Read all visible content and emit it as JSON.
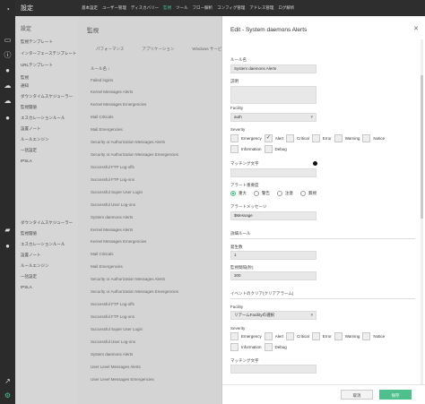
{
  "app": {
    "title": "設定"
  },
  "topnav": [
    "基本設定",
    "ユーザー管理",
    "ディスカバリー",
    "監視",
    "ツール",
    "フロー解析",
    "コンフィグ管理",
    "アドレス管理",
    "ログ解析"
  ],
  "topnav_active_index": 3,
  "rail_icons": [
    "dashboard-icon",
    "desktop-icon",
    "info-icon",
    "map-pin-icon",
    "cloud-icon",
    "user-icon",
    "chat-icon",
    "user-icon",
    "chart-icon",
    "settings-icon"
  ],
  "sidebar": {
    "heading": "設定",
    "items": [
      "監視テンプレート",
      "インターフェーステンプレート",
      "URLテンプレート",
      "監視",
      "通知",
      "ダウンタイムスケジューラー",
      "監視閾値",
      "エスカレーションルール",
      "設置ノート",
      "ルールエンジン",
      "一括設定",
      "IPSLA",
      "",
      "",
      "",
      "",
      "ダウンタイムスケジューラー",
      "監視閾値",
      "エスカレーションルール",
      "設置ノート",
      "ルールエンジン",
      "一括設定",
      "IPSLA"
    ]
  },
  "main": {
    "heading": "監視",
    "tabs": [
      "パフォーマンス",
      "アプリケーション",
      "Windows サービス"
    ],
    "column_header": "ルール名 ↓",
    "rows": [
      "Failed logins",
      "Kernel Messages Alerts",
      "Kernel Messages Emergencies",
      "Mail Criticals",
      "Mail Emergencies",
      "Security or Authorization Messages Alerts",
      "Security or Authorization Messages Emergencies",
      "Successful FTP Log-offs",
      "Successful FTP Log-ons",
      "Successful Super User Login",
      "Successful User Log-ons",
      "System daemons Alerts",
      "Kernel Messages Alerts",
      "Kernel Messages Emergencies",
      "Mail Criticals",
      "Mail Emergencies",
      "Security or Authorization Messages Alerts",
      "Security or Authorization Messages Emergencies",
      "Successful FTP Log-offs",
      "Successful FTP Log-ons",
      "Successful Super User Login",
      "Successful User Log-ons",
      "System daemons Alerts",
      "User Level Messages Alerts",
      "User Level Messages Emergencies"
    ]
  },
  "panel": {
    "title": "Edit - System daemons Alerts",
    "rule_name_label": "ルール名",
    "rule_name_value": "System daemons Alerts",
    "description_label": "説明",
    "description_value": "",
    "facility_label": "Facility",
    "facility_value": "auth",
    "severity_label": "Severity",
    "severities": [
      {
        "label": "Emergency",
        "checked": false
      },
      {
        "label": "Alert",
        "checked": true
      },
      {
        "label": "Critical",
        "checked": false
      },
      {
        "label": "Error",
        "checked": false
      },
      {
        "label": "Warning",
        "checked": false
      },
      {
        "label": "Notice",
        "checked": false
      },
      {
        "label": "Information",
        "checked": false
      },
      {
        "label": "Debug",
        "checked": false
      }
    ],
    "match_text_label": "マッチング文字",
    "match_text_value": "",
    "alert_severity_label": "アラート重要度",
    "alert_severities": [
      {
        "label": "重大",
        "selected": true
      },
      {
        "label": "警告",
        "selected": false
      },
      {
        "label": "注意",
        "selected": false
      },
      {
        "label": "無視",
        "selected": false
      }
    ],
    "alert_message_label": "アラートメッセージ",
    "alert_message_value": "$Message",
    "detail_section": "詳細ルール",
    "occurrence_label": "発生数",
    "occurrence_value": "1",
    "interval_label": "監視間隔(秒)",
    "interval_value": "300",
    "after_section": "イベントのクリア(クリアアラーム)",
    "facility2_label": "Facility",
    "facility2_placeholder": "リアームFacilityの選択",
    "severity2_label": "Severity",
    "severities2": [
      "Emergency",
      "Alert",
      "Critical",
      "Error",
      "Warning",
      "Notice",
      "Information",
      "Debug"
    ],
    "match_text2_label": "マッチング文字",
    "cancel_label": "取消",
    "save_label": "保存"
  },
  "colors": {
    "accent": "#4fc08d",
    "rail": "#2b2b2b",
    "topbar": "#2e2e2e"
  }
}
